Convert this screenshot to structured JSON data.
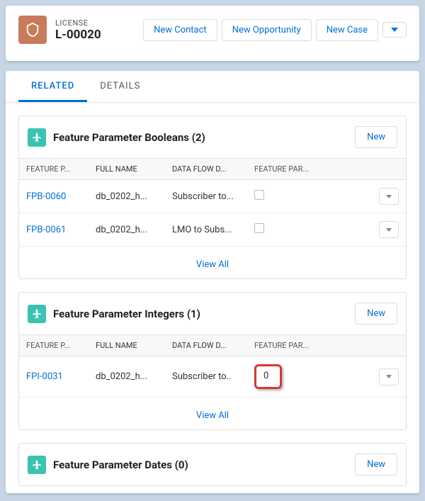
{
  "header": {
    "object_label": "LICENSE",
    "record_name": "L-00020",
    "actions": {
      "new_contact": "New Contact",
      "new_opportunity": "New Opportunity",
      "new_case": "New Case"
    }
  },
  "tabs": {
    "related": "RELATED",
    "details": "DETAILS"
  },
  "columns": {
    "c1": "FEATURE P...",
    "c2": "FULL NAME",
    "c3": "DATA FLOW D...",
    "c4": "FEATURE PAR..."
  },
  "booleans": {
    "title": "Feature Parameter Booleans (2)",
    "new_label": "New",
    "rows": [
      {
        "id": "FPB-0060",
        "full_name": "db_0202_h...",
        "flow": "Subscriber to..."
      },
      {
        "id": "FPB-0061",
        "full_name": "db_0202_h...",
        "flow": "LMO to Subs..."
      }
    ],
    "view_all": "View All"
  },
  "integers": {
    "title": "Feature Parameter Integers (1)",
    "new_label": "New",
    "rows": [
      {
        "id": "FPI-0031",
        "full_name": "db_0202_h...",
        "flow": "Subscriber to..",
        "value": "0"
      }
    ],
    "view_all": "View All"
  },
  "dates": {
    "title": "Feature Parameter Dates (0)",
    "new_label": "New"
  }
}
